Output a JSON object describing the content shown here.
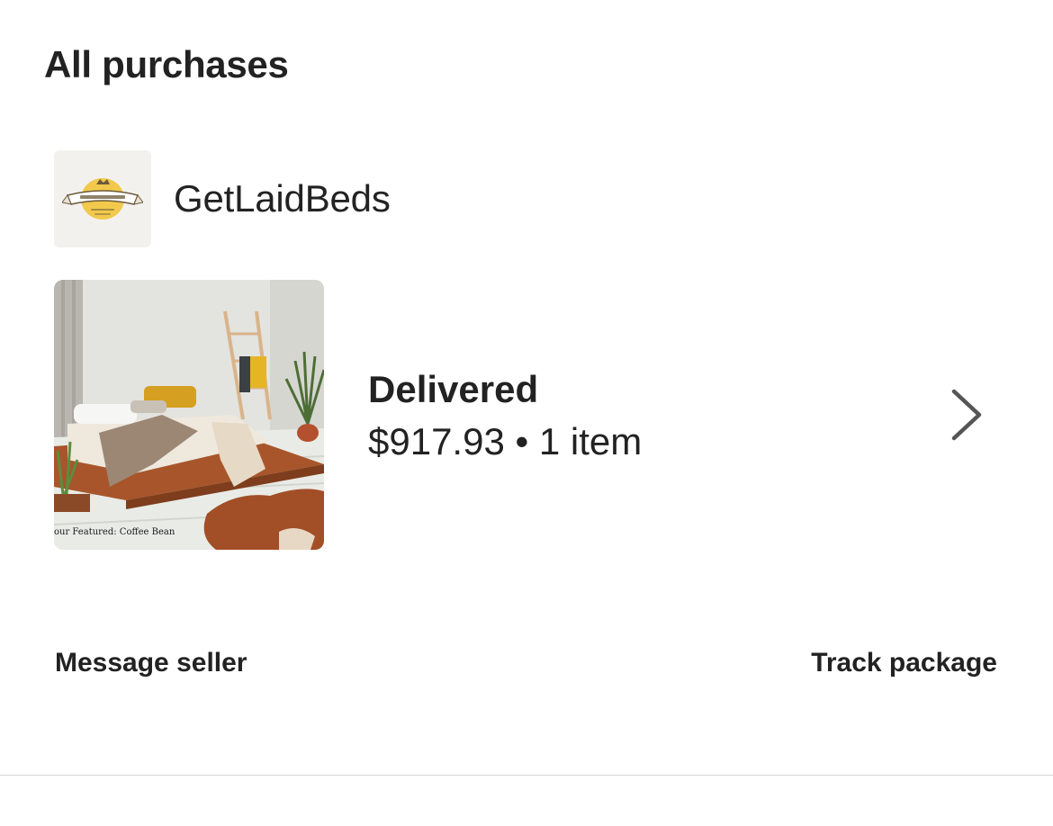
{
  "page": {
    "title": "All purchases"
  },
  "shop": {
    "name": "GetLaidBeds",
    "logo_text": "GET LAID BEDS",
    "logo_colors": {
      "badge": "#f2c94c",
      "ribbon": "#ffffff",
      "text": "#5a4a2a"
    }
  },
  "order": {
    "status": "Delivered",
    "summary": "$917.93 • 1 item",
    "thumbnail_caption": "our Featured: Coffee Bean",
    "chevron_icon": "chevron-right-icon"
  },
  "actions": {
    "message_seller": "Message seller",
    "track_package": "Track package"
  },
  "colors": {
    "text": "#222222",
    "divider": "#d6d6d6",
    "avatar_bg": "#f3f1ee"
  }
}
